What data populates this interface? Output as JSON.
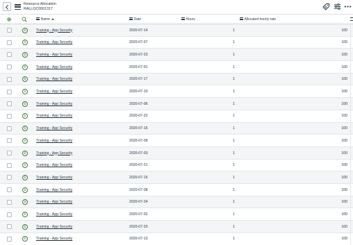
{
  "header": {
    "title": "Resource Allocation",
    "record_number": "RALLOC0001317"
  },
  "icons": {
    "back": "chevron-left-icon",
    "menu": "hamburger-icon",
    "tag": "tag-icon",
    "filter": "sliders-icon",
    "more": "more-icon",
    "settings": "gear-icon",
    "search": "search-icon",
    "info": "info-icon"
  },
  "columns": {
    "name": "Name",
    "date": "Date",
    "hours": "Hours",
    "rate": "Allocated hourly rate",
    "sort": "ascending"
  },
  "rows": [
    {
      "name": "Training - App Security",
      "date": "2020-07-14",
      "hours": "1",
      "rate": "100"
    },
    {
      "name": "Training - App Security",
      "date": "2020-07-07",
      "hours": "1",
      "rate": "100"
    },
    {
      "name": "Training - App Security",
      "date": "2020-07-23",
      "hours": "1",
      "rate": "100"
    },
    {
      "name": "Training - App Security",
      "date": "2020-07-01",
      "hours": "1",
      "rate": "100"
    },
    {
      "name": "Training - App Security",
      "date": "2020-07-17",
      "hours": "1",
      "rate": "100"
    },
    {
      "name": "Training - App Security",
      "date": "2020-07-10",
      "hours": "1",
      "rate": "100"
    },
    {
      "name": "Training - App Security",
      "date": "2020-07-06",
      "hours": "1",
      "rate": "100"
    },
    {
      "name": "Training - App Security",
      "date": "2020-07-22",
      "hours": "1",
      "rate": "100"
    },
    {
      "name": "Training - App Security",
      "date": "2020-07-16",
      "hours": "1",
      "rate": "100"
    },
    {
      "name": "Training - App Security",
      "date": "2020-07-09",
      "hours": "1",
      "rate": "100"
    },
    {
      "name": "Training - App Security",
      "date": "2020-07-03",
      "hours": "1",
      "rate": "100"
    },
    {
      "name": "Training - App Security",
      "date": "2020-07-21",
      "hours": "1",
      "rate": "100"
    },
    {
      "name": "Training - App Security",
      "date": "2020-07-15",
      "hours": "1",
      "rate": "100"
    },
    {
      "name": "Training - App Security",
      "date": "2020-07-08",
      "hours": "1",
      "rate": "100"
    },
    {
      "name": "Training - App Security",
      "date": "2020-07-24",
      "hours": "1",
      "rate": "100"
    },
    {
      "name": "Training - App Security",
      "date": "2020-07-02",
      "hours": "1",
      "rate": "100"
    },
    {
      "name": "Training - App Security",
      "date": "2020-07-20",
      "hours": "1",
      "rate": "100"
    },
    {
      "name": "Training - App Security",
      "date": "2020-07-13",
      "hours": "1",
      "rate": "100"
    }
  ]
}
